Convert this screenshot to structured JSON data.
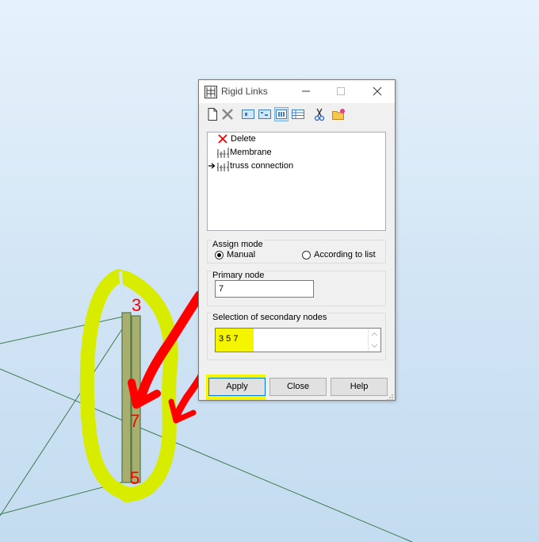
{
  "dialog": {
    "title": "Rigid Links",
    "window_controls": [
      "minimize-icon",
      "maximize-icon",
      "close-icon"
    ],
    "toolbar_icons": [
      "new-icon",
      "delete-icon",
      "view-1-icon",
      "view-2-icon",
      "view-3-icon",
      "table-icon",
      "cut-icon",
      "open-folder-icon"
    ],
    "list": {
      "items": [
        {
          "label": "Delete",
          "icon": "delete-x-icon",
          "selected": false
        },
        {
          "label": "Membrane",
          "icon": "rigid-link-icon",
          "selected": false
        },
        {
          "label": "truss connection",
          "icon": "rigid-link-icon",
          "selected": true
        }
      ]
    },
    "assign_mode": {
      "title": "Assign mode",
      "options": [
        "Manual",
        "According to list"
      ],
      "selected": "Manual"
    },
    "primary_node": {
      "title": "Primary node",
      "value": "7"
    },
    "secondary_nodes": {
      "title": "Selection of secondary nodes",
      "value": "3 5 7"
    },
    "buttons": {
      "apply": "Apply",
      "close": "Close",
      "help": "Help"
    },
    "highlight_color": "#f5f500"
  },
  "viewport": {
    "node_labels": [
      "3",
      "7",
      "5"
    ],
    "annotation_color": "#ff0000",
    "highlight_color": "#d8ec00",
    "member_color": "#a9ad6e"
  }
}
